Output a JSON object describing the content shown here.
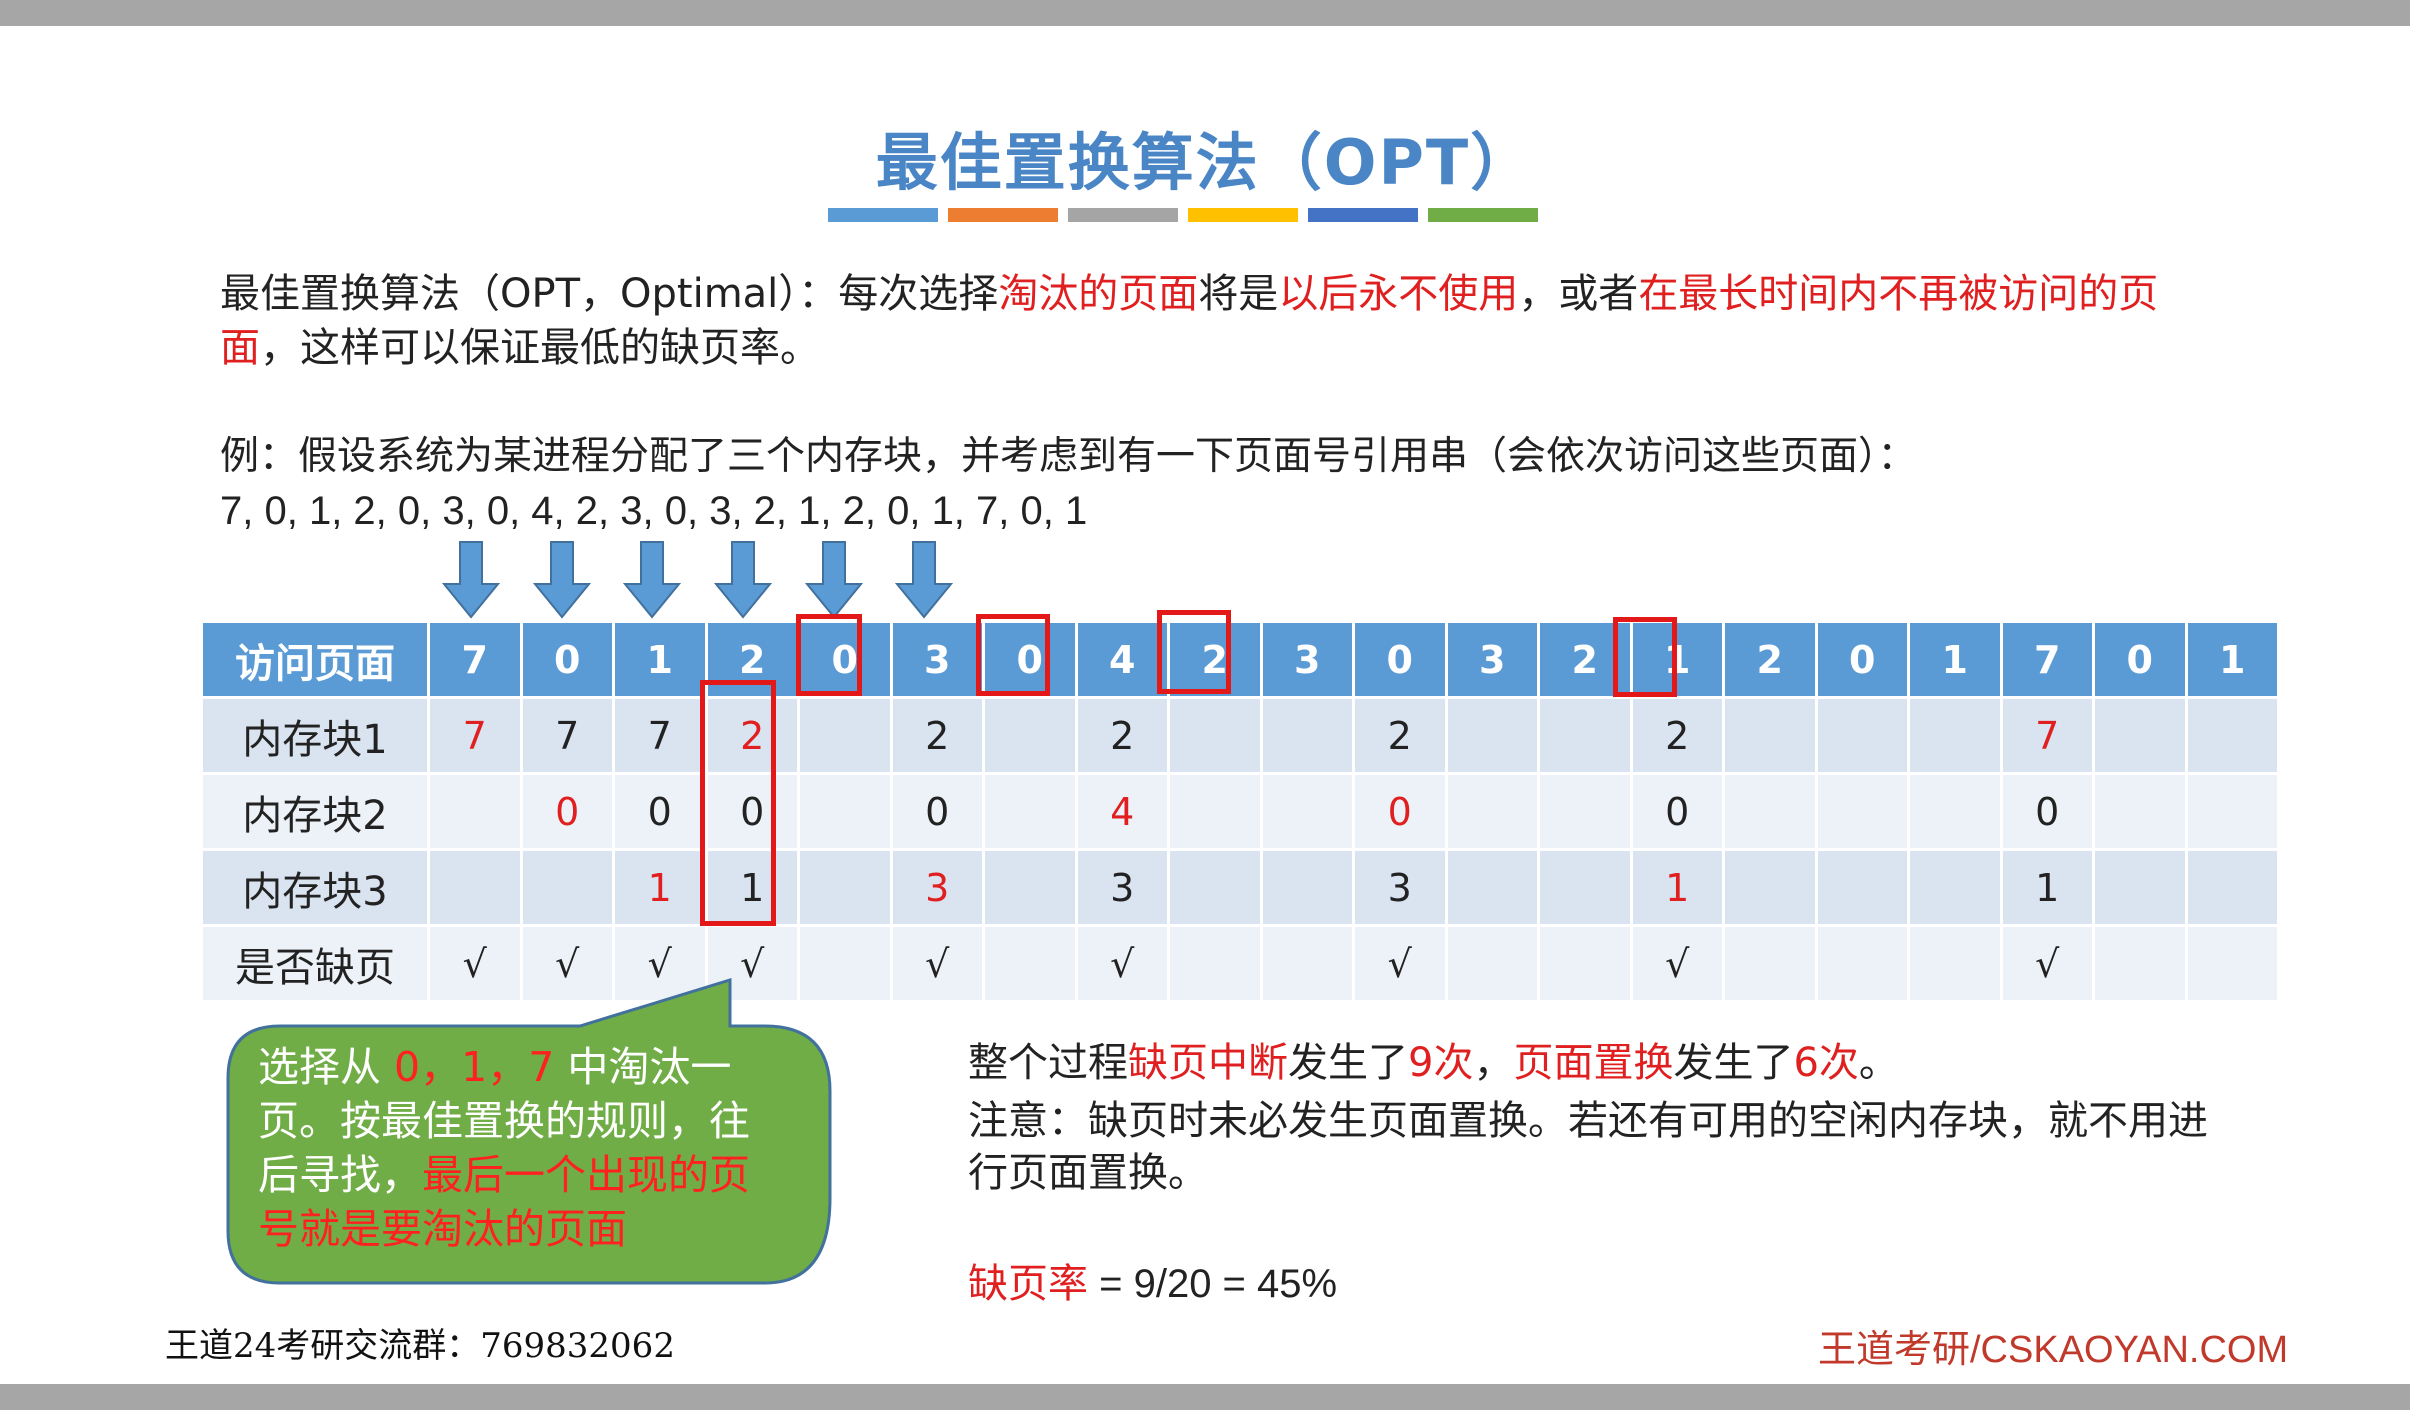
{
  "title": "最佳置换算法（OPT）",
  "stripe_colors": [
    "#5b9bd5",
    "#ed7d31",
    "#a5a5a5",
    "#ffc000",
    "#4472c4",
    "#70ad47"
  ],
  "definition": {
    "p1": "最佳置换算法（OPT，Optimal）：每次选择",
    "h1": "淘汰的页面",
    "p2": "将是",
    "h2": "以后永不使用",
    "p3": "，或者",
    "h3": "在最长时间内不再被访问的页面",
    "p4": "，这样可以保证最低的缺页率。"
  },
  "example": {
    "line1": "例：假设系统为某进程分配了三个内存块，并考虑到有一下页面号引用串（会依次访问这些页面）：",
    "line2": "7, 0, 1, 2, 0, 3, 0, 4, 2, 3, 0, 3, 2, 1, 2, 0, 1, 7, 0, 1"
  },
  "table": {
    "header_label": "访问页面",
    "pages": [
      "7",
      "0",
      "1",
      "2",
      "0",
      "3",
      "0",
      "4",
      "2",
      "3",
      "0",
      "3",
      "2",
      "1",
      "2",
      "0",
      "1",
      "7",
      "0",
      "1"
    ],
    "rows": [
      {
        "label": "内存块1",
        "cells": [
          "7",
          "7",
          "7",
          "2",
          "",
          "2",
          "",
          "2",
          "",
          "",
          "2",
          "",
          "",
          "2",
          "",
          "",
          "",
          "7",
          "",
          ""
        ]
      },
      {
        "label": "内存块2",
        "cells": [
          "",
          "0",
          "0",
          "0",
          "",
          "0",
          "",
          "4",
          "",
          "",
          "0",
          "",
          "",
          "0",
          "",
          "",
          "",
          "0",
          "",
          ""
        ]
      },
      {
        "label": "内存块3",
        "cells": [
          "",
          "",
          "1",
          "1",
          "",
          "3",
          "",
          "3",
          "",
          "",
          "3",
          "",
          "",
          "1",
          "",
          "",
          "",
          "1",
          "",
          ""
        ]
      },
      {
        "label": "是否缺页",
        "cells": [
          "√",
          "√",
          "√",
          "√",
          "",
          "√",
          "",
          "√",
          "",
          "",
          "√",
          "",
          "",
          "√",
          "",
          "",
          "",
          "√",
          "",
          ""
        ]
      }
    ]
  },
  "callout": {
    "t1": "选择从 ",
    "h1": "0，1，7",
    "t2": " 中淘汰一页。按最佳置换的规则，往后寻找，",
    "h2": "最后一个出现的页号就是要淘汰的页面",
    "color": "#70ad47"
  },
  "summary": {
    "s1": "整个过程",
    "h1": "缺页中断",
    "s2": "发生了",
    "h2": "9次",
    "s3": "，",
    "h3": "页面置换",
    "s4": "发生了",
    "h4": "6次",
    "s5": "。",
    "note": "注意：缺页时未必发生页面置换。若还有可用的空闲内存块，就不用进行页面置换。",
    "rate_label": "缺页率",
    "rate_value": " = 9/20 = 45%"
  },
  "footer": {
    "left": "王道24考研交流群：769832062",
    "right": "王道考研/CSKAOYAN.COM"
  }
}
